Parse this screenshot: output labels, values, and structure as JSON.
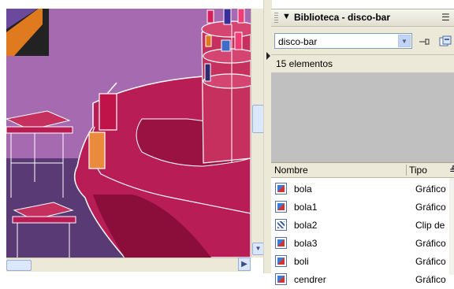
{
  "library": {
    "title": "Biblioteca - disco-bar",
    "selected_library": "disco-bar",
    "item_count": "15 elementos",
    "columns": {
      "name": "Nombre",
      "type": "Tipo"
    },
    "items": [
      {
        "name": "bola",
        "type": "Gráfico",
        "icon": "graphic-symbol-icon"
      },
      {
        "name": "bola1",
        "type": "Gráfico",
        "icon": "graphic-symbol-icon"
      },
      {
        "name": "bola2",
        "type": "Clip de",
        "icon": "movieclip-symbol-icon"
      },
      {
        "name": "bola3",
        "type": "Gráfico",
        "icon": "graphic-symbol-icon"
      },
      {
        "name": "boli",
        "type": "Gráfico",
        "icon": "graphic-symbol-icon"
      },
      {
        "name": "cendrer",
        "type": "Gráfico",
        "icon": "graphic-symbol-icon"
      }
    ]
  },
  "colors": {
    "stage_background": "#a66ab1",
    "bar_top": "#c6305e",
    "bar_dark": "#9a1242",
    "outline": "#ffffff",
    "panel_bg": "#ece9d8",
    "preview_bg": "#c0c0c0"
  },
  "icons": {
    "panel_menu": "options-menu-icon",
    "pin": "pin-icon",
    "new_library": "new-library-icon",
    "collapse": "triangle-down-icon"
  }
}
